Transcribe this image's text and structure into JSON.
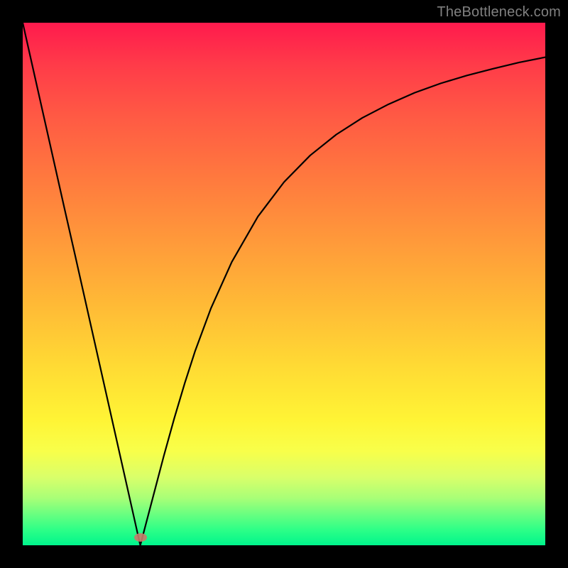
{
  "watermark": "TheBottleneck.com",
  "marker": {
    "x_frac": 0.225,
    "y_frac": 0.985
  },
  "chart_data": {
    "type": "line",
    "title": "",
    "xlabel": "",
    "ylabel": "",
    "xlim": [
      0,
      1
    ],
    "ylim": [
      0,
      1
    ],
    "x": [
      0.0,
      0.02,
      0.04,
      0.06,
      0.08,
      0.1,
      0.12,
      0.14,
      0.16,
      0.18,
      0.2,
      0.22,
      0.225,
      0.23,
      0.25,
      0.27,
      0.29,
      0.31,
      0.33,
      0.36,
      0.4,
      0.45,
      0.5,
      0.55,
      0.6,
      0.65,
      0.7,
      0.75,
      0.8,
      0.85,
      0.9,
      0.95,
      1.0
    ],
    "values": [
      1.0,
      0.911,
      0.822,
      0.733,
      0.644,
      0.556,
      0.467,
      0.378,
      0.289,
      0.2,
      0.111,
      0.022,
      0.0,
      0.019,
      0.095,
      0.171,
      0.243,
      0.31,
      0.372,
      0.453,
      0.542,
      0.629,
      0.695,
      0.746,
      0.786,
      0.818,
      0.844,
      0.866,
      0.884,
      0.899,
      0.912,
      0.924,
      0.934
    ],
    "gradient_stops": [
      {
        "pos": 0.0,
        "color": "#ff1a4d"
      },
      {
        "pos": 0.3,
        "color": "#ff7a3e"
      },
      {
        "pos": 0.66,
        "color": "#ffdb34"
      },
      {
        "pos": 0.82,
        "color": "#f8ff4a"
      },
      {
        "pos": 1.0,
        "color": "#00f58c"
      }
    ],
    "marker": {
      "x": 0.225,
      "y": 0.015,
      "color": "#c97a6a"
    }
  }
}
